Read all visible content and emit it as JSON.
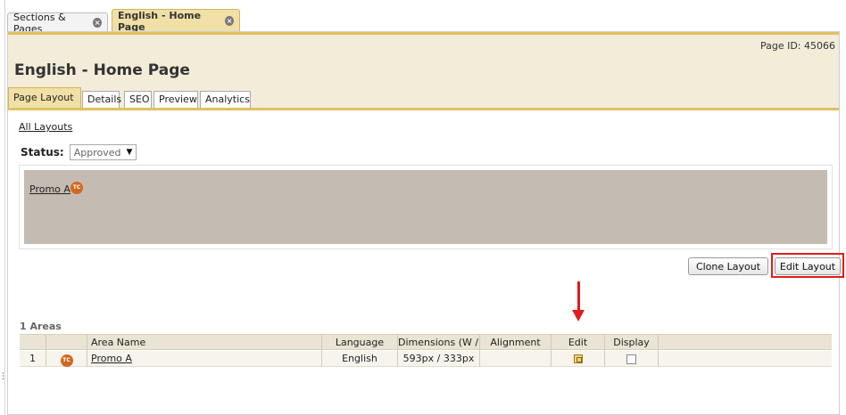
{
  "top_tabs": [
    {
      "label": "Sections & Pages"
    },
    {
      "label": "English - Home Page"
    }
  ],
  "header": {
    "page_id": "Page ID: 45066",
    "title": "English - Home Page"
  },
  "sub_tabs": [
    "Page Layout",
    "Details",
    "SEO",
    "Preview",
    "Analytics"
  ],
  "all_layouts_link": "All Layouts",
  "status": {
    "label": "Status:",
    "value": "Approved"
  },
  "preview": {
    "area_link": "Promo A",
    "badge": "TC"
  },
  "buttons": {
    "clone_layout": "Clone Layout",
    "edit_layout": "Edit Layout"
  },
  "areas": {
    "title": "1 Areas",
    "columns": [
      "",
      "",
      "Area Name",
      "Language",
      "Dimensions (W / H)",
      "Alignment",
      "Edit",
      "Display"
    ],
    "rows": [
      {
        "index": "1",
        "badge": "TC",
        "name": "Promo A",
        "language": "English",
        "dimensions": "593px / 333px",
        "alignment": "",
        "display_checked": false
      }
    ]
  },
  "colors": {
    "accent_gold": "#e0c15d",
    "header_bg": "#f2ecd9",
    "preview_bg": "#c4bcb2",
    "annotation_red": "#e21b1b",
    "badge_orange": "#d2691e"
  }
}
